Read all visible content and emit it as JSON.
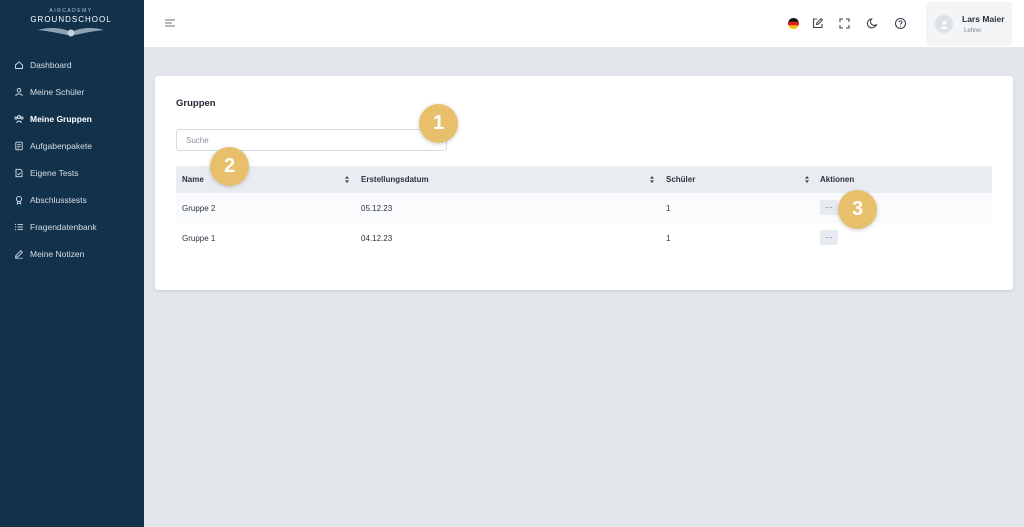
{
  "logo": {
    "sup": "AIRCADEMY",
    "main": "GROUNDSCHOOL"
  },
  "sidebar": {
    "items": [
      {
        "label": "Dashboard",
        "icon": "home-icon",
        "active": false
      },
      {
        "label": "Meine Schüler",
        "icon": "user-icon",
        "active": false
      },
      {
        "label": "Meine Gruppen",
        "icon": "group-icon",
        "active": true
      },
      {
        "label": "Aufgabenpakete",
        "icon": "package-icon",
        "active": false
      },
      {
        "label": "Eigene Tests",
        "icon": "test-icon",
        "active": false
      },
      {
        "label": "Abschlusstests",
        "icon": "award-icon",
        "active": false
      },
      {
        "label": "Fragendatenbank",
        "icon": "list-icon",
        "active": false
      },
      {
        "label": "Meine Notizen",
        "icon": "pen-icon",
        "active": false
      }
    ]
  },
  "topbar": {
    "icons": [
      "german-flag-icon",
      "edit-icon",
      "fullscreen-icon",
      "moon-icon",
      "help-icon"
    ],
    "user": {
      "name": "Lars Maier",
      "role": "Lehrer"
    }
  },
  "main": {
    "title": "Gruppen",
    "search": {
      "placeholder": "Suche",
      "value": ""
    },
    "table": {
      "columns": [
        "Name",
        "Erstellungsdatum",
        "Schüler",
        "Aktionen"
      ],
      "rows": [
        {
          "name": "Gruppe 2",
          "date": "05.12.23",
          "students": "1",
          "action": "···"
        },
        {
          "name": "Gruppe 1",
          "date": "04.12.23",
          "students": "1",
          "action": "···"
        }
      ]
    }
  },
  "badges": [
    "1",
    "2",
    "3"
  ],
  "colors": {
    "sidebar": "#12324c",
    "badge": "#e8bf6a",
    "background": "#e3e7eb"
  }
}
